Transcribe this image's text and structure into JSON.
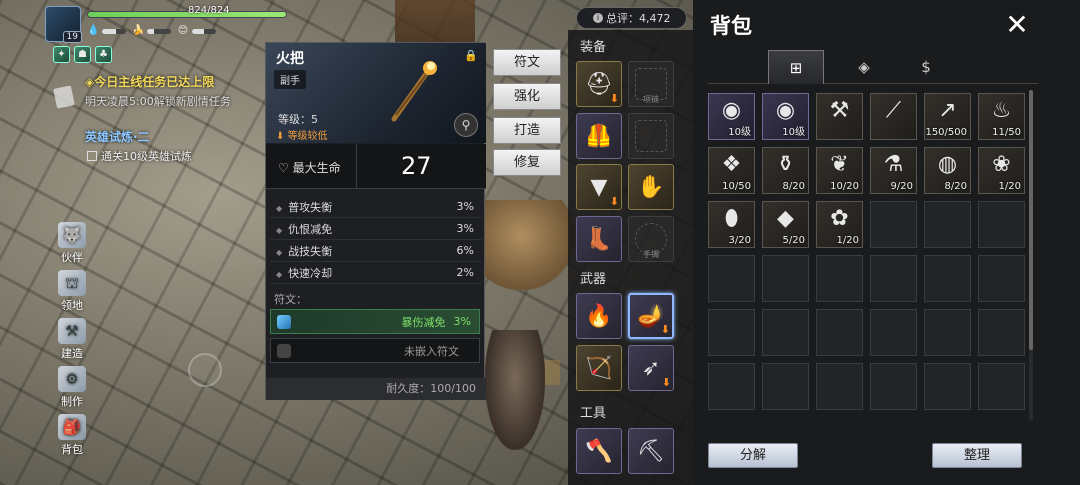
{
  "player": {
    "level": "19",
    "hp_text": "824/824",
    "hp_fraction": 1.0,
    "stats": [
      {
        "icon": "water-drop-icon",
        "glyph": "💧",
        "fill": 0.6
      },
      {
        "icon": "banana-icon",
        "glyph": "🍌",
        "fill": 0.3
      },
      {
        "icon": "smile-icon",
        "glyph": "😊",
        "fill": 0.5
      }
    ]
  },
  "quest": {
    "title": "◈今日主线任务已达上限",
    "subtitle": "明天凌晨5:00解锁新剧情任务",
    "trial_title": "英雄试炼·二",
    "trial_sub": "通关10级英雄试炼"
  },
  "sidemenu": [
    "伙伴",
    "领地",
    "建造",
    "制作",
    "背包"
  ],
  "detail": {
    "name": "火把",
    "type": "副手",
    "level": "等级：5",
    "warning": "等级较低",
    "hp_label": "最大生命",
    "hp_value": "27",
    "stats": [
      {
        "label": "普攻失衡",
        "value": "3%"
      },
      {
        "label": "仇恨减免",
        "value": "3%"
      },
      {
        "label": "战技失衡",
        "value": "6%"
      },
      {
        "label": "快速冷却",
        "value": "2%"
      }
    ],
    "rune_label": "符文：",
    "rune_active": {
      "label": "暴伤减免",
      "value": "3%"
    },
    "rune_empty": "未嵌入符文",
    "durability": "耐久度：100/100"
  },
  "actions": [
    "符文",
    "强化",
    "打造",
    "修复"
  ],
  "equip": {
    "score": "总评：4,472",
    "section_equip": "装备",
    "section_weapon": "武器",
    "section_tool": "工具",
    "slot_captions": {
      "helmet": "项链",
      "ring": "手镯"
    }
  },
  "bag": {
    "title": "背包",
    "tabs": [
      {
        "icon": "chest-icon",
        "glyph": "⊞"
      },
      {
        "icon": "compass-icon",
        "glyph": "◈"
      },
      {
        "icon": "coin-icon",
        "glyph": "$"
      }
    ],
    "items": [
      {
        "icon": "shield-icon",
        "glyph": "◉",
        "qty": "10级",
        "rare": true
      },
      {
        "icon": "shield-icon",
        "glyph": "◉",
        "qty": "10级",
        "rare": true
      },
      {
        "icon": "shovel-icon",
        "glyph": "⚒",
        "qty": ""
      },
      {
        "icon": "staff-icon",
        "glyph": "⟋",
        "qty": ""
      },
      {
        "icon": "spear-icon",
        "glyph": "↗",
        "qty": "150/500"
      },
      {
        "icon": "ladle-icon",
        "glyph": "♨",
        "qty": "11/50"
      },
      {
        "icon": "crystal-icon",
        "glyph": "❖",
        "qty": "10/50"
      },
      {
        "icon": "potion-icon",
        "glyph": "⚱",
        "qty": "8/20"
      },
      {
        "icon": "herb-icon",
        "glyph": "❦",
        "qty": "10/20"
      },
      {
        "icon": "flask-icon",
        "glyph": "⚗",
        "qty": "9/20"
      },
      {
        "icon": "jam-jar-icon",
        "glyph": "◍",
        "qty": "8/20"
      },
      {
        "icon": "berry-icon",
        "glyph": "❀",
        "qty": "1/20"
      },
      {
        "icon": "sweet-potato-icon",
        "glyph": "⬮",
        "qty": "3/20"
      },
      {
        "icon": "meat-icon",
        "glyph": "◆",
        "qty": "5/20"
      },
      {
        "icon": "seeds-icon",
        "glyph": "✿",
        "qty": "1/20"
      }
    ],
    "btn_left": "分解",
    "btn_right": "整理",
    "close": "✕"
  }
}
